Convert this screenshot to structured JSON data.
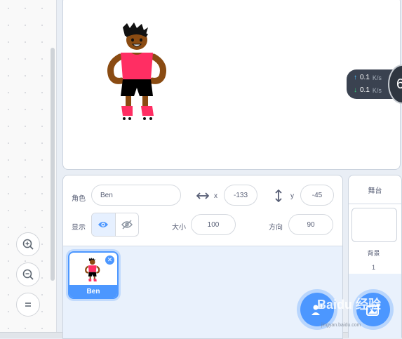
{
  "sprite_info": {
    "sprite_label": "角色",
    "sprite_name": "Ben",
    "x_label": "x",
    "x_value": "-133",
    "y_label": "y",
    "y_value": "-45",
    "show_label": "显示",
    "size_label": "大小",
    "size_value": "100",
    "direction_label": "方向",
    "direction_value": "90"
  },
  "sprites": [
    {
      "name": "Ben"
    }
  ],
  "stage_panel": {
    "title": "舞台",
    "backdrop_label": "背景",
    "backdrop_count": "1"
  },
  "net_speed": {
    "upload": "0.1",
    "download": "0.1",
    "unit": "K/s",
    "badge": "6"
  },
  "watermark": {
    "text": "Baidu 经验",
    "url": "jingyan.baidu.com"
  },
  "colors": {
    "accent": "#4c97ff",
    "shirt": "#ff2e63",
    "skin": "#8a4b12"
  }
}
